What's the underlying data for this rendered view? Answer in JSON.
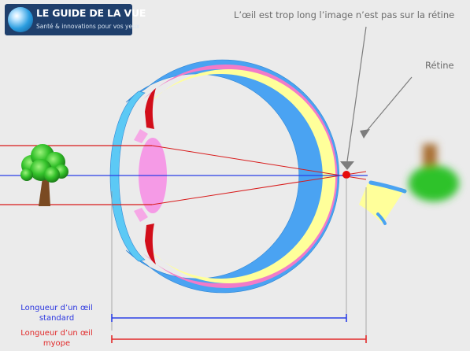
{
  "logo": {
    "title": "LE GUIDE DE LA VUE",
    "subtitle": "Santé & innovations pour vos yeux"
  },
  "labels": {
    "long_eye": "L’œil est trop long l’image n’est pas sur la rétine",
    "retina": "Rétine"
  },
  "lengths": {
    "standard_line1": "Longueur d’un œil",
    "standard_line2": "standard",
    "myopic_line1": "Longueur d’un œil",
    "myopic_line2": "myope"
  },
  "colors": {
    "sclera": "#4aa3f2",
    "choroid": "#f27bc8",
    "retina": "#ffff9a",
    "cornea": "#5cc9f5",
    "lens": "#f59ae6",
    "iris": "#d20e1a",
    "ray": "#d81b1b",
    "axis": "#2b3fe6",
    "focus_point": "#e60b0b",
    "caption": "#6b6b6b"
  }
}
